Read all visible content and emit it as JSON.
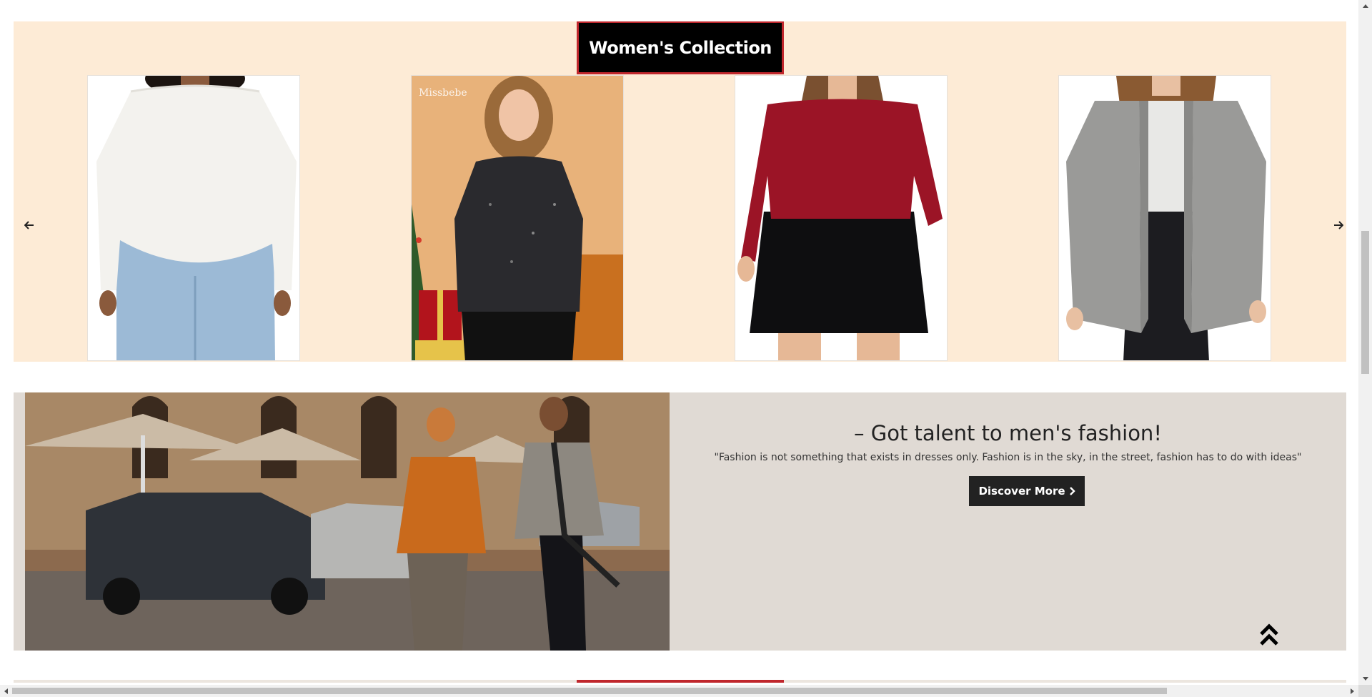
{
  "women_collection": {
    "title": "Women's Collection",
    "prev_icon": "arrow-left-icon",
    "next_icon": "arrow-right-icon",
    "products": [
      {
        "name": "white-sweater",
        "color": "#f3f2ee"
      },
      {
        "name": "black-sparkle-sweater",
        "color": "#2a2a2e"
      },
      {
        "name": "red-top-black-skirt",
        "color": "#9b1426"
      },
      {
        "name": "grey-cardigan",
        "color": "#9a9a98"
      }
    ],
    "watermark": "Missbebe"
  },
  "mens_banner": {
    "heading": "– Got talent to men's fashion!",
    "quote": "\"Fashion is not something that exists in dresses only. Fashion is in the sky, in the street, fashion has to do with ideas\"",
    "button_label": "Discover More",
    "button_icon": "chevron-right-icon"
  },
  "scroll_top_icon": "double-chevron-up-icon",
  "colors": {
    "collection_bg": "#fdebd6",
    "banner_bg": "#e0dad4",
    "accent_red": "#c0272d",
    "dark": "#222222"
  }
}
